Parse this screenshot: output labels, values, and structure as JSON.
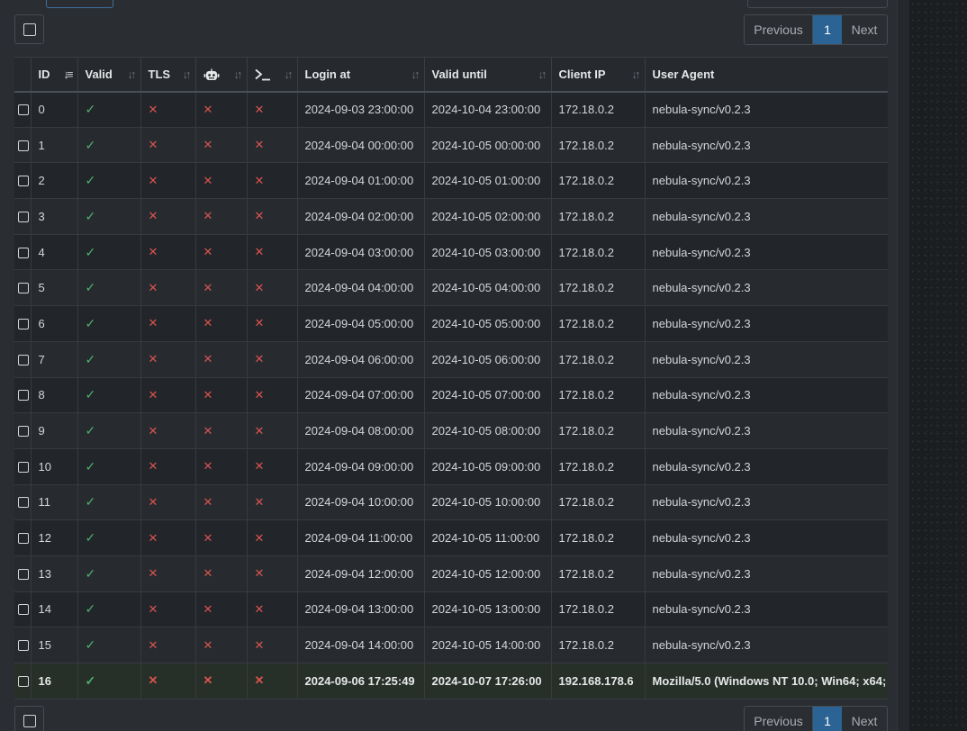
{
  "pagination": {
    "previous": "Previous",
    "page": "1",
    "next": "Next"
  },
  "columns": [
    {
      "key": "select",
      "label": ""
    },
    {
      "key": "id",
      "label": "ID"
    },
    {
      "key": "valid",
      "label": "Valid"
    },
    {
      "key": "tls",
      "label": "TLS"
    },
    {
      "key": "bot",
      "label": "",
      "icon": "robot-icon"
    },
    {
      "key": "cli",
      "label": "",
      "icon": "terminal-icon"
    },
    {
      "key": "login_at",
      "label": "Login at"
    },
    {
      "key": "valid_until",
      "label": "Valid until"
    },
    {
      "key": "client_ip",
      "label": "Client IP"
    },
    {
      "key": "user_agent",
      "label": "User Agent"
    }
  ],
  "symbols": {
    "check": "✓",
    "cross": "✕"
  },
  "rows": [
    {
      "id": "0",
      "valid": true,
      "tls": false,
      "bot": false,
      "cli": false,
      "login_at": "2024-09-03 23:00:00",
      "valid_until": "2024-10-04 23:00:00",
      "client_ip": "172.18.0.2",
      "user_agent": "nebula-sync/v0.2.3"
    },
    {
      "id": "1",
      "valid": true,
      "tls": false,
      "bot": false,
      "cli": false,
      "login_at": "2024-09-04 00:00:00",
      "valid_until": "2024-10-05 00:00:00",
      "client_ip": "172.18.0.2",
      "user_agent": "nebula-sync/v0.2.3"
    },
    {
      "id": "2",
      "valid": true,
      "tls": false,
      "bot": false,
      "cli": false,
      "login_at": "2024-09-04 01:00:00",
      "valid_until": "2024-10-05 01:00:00",
      "client_ip": "172.18.0.2",
      "user_agent": "nebula-sync/v0.2.3"
    },
    {
      "id": "3",
      "valid": true,
      "tls": false,
      "bot": false,
      "cli": false,
      "login_at": "2024-09-04 02:00:00",
      "valid_until": "2024-10-05 02:00:00",
      "client_ip": "172.18.0.2",
      "user_agent": "nebula-sync/v0.2.3"
    },
    {
      "id": "4",
      "valid": true,
      "tls": false,
      "bot": false,
      "cli": false,
      "login_at": "2024-09-04 03:00:00",
      "valid_until": "2024-10-05 03:00:00",
      "client_ip": "172.18.0.2",
      "user_agent": "nebula-sync/v0.2.3"
    },
    {
      "id": "5",
      "valid": true,
      "tls": false,
      "bot": false,
      "cli": false,
      "login_at": "2024-09-04 04:00:00",
      "valid_until": "2024-10-05 04:00:00",
      "client_ip": "172.18.0.2",
      "user_agent": "nebula-sync/v0.2.3"
    },
    {
      "id": "6",
      "valid": true,
      "tls": false,
      "bot": false,
      "cli": false,
      "login_at": "2024-09-04 05:00:00",
      "valid_until": "2024-10-05 05:00:00",
      "client_ip": "172.18.0.2",
      "user_agent": "nebula-sync/v0.2.3"
    },
    {
      "id": "7",
      "valid": true,
      "tls": false,
      "bot": false,
      "cli": false,
      "login_at": "2024-09-04 06:00:00",
      "valid_until": "2024-10-05 06:00:00",
      "client_ip": "172.18.0.2",
      "user_agent": "nebula-sync/v0.2.3"
    },
    {
      "id": "8",
      "valid": true,
      "tls": false,
      "bot": false,
      "cli": false,
      "login_at": "2024-09-04 07:00:00",
      "valid_until": "2024-10-05 07:00:00",
      "client_ip": "172.18.0.2",
      "user_agent": "nebula-sync/v0.2.3"
    },
    {
      "id": "9",
      "valid": true,
      "tls": false,
      "bot": false,
      "cli": false,
      "login_at": "2024-09-04 08:00:00",
      "valid_until": "2024-10-05 08:00:00",
      "client_ip": "172.18.0.2",
      "user_agent": "nebula-sync/v0.2.3"
    },
    {
      "id": "10",
      "valid": true,
      "tls": false,
      "bot": false,
      "cli": false,
      "login_at": "2024-09-04 09:00:00",
      "valid_until": "2024-10-05 09:00:00",
      "client_ip": "172.18.0.2",
      "user_agent": "nebula-sync/v0.2.3"
    },
    {
      "id": "11",
      "valid": true,
      "tls": false,
      "bot": false,
      "cli": false,
      "login_at": "2024-09-04 10:00:00",
      "valid_until": "2024-10-05 10:00:00",
      "client_ip": "172.18.0.2",
      "user_agent": "nebula-sync/v0.2.3"
    },
    {
      "id": "12",
      "valid": true,
      "tls": false,
      "bot": false,
      "cli": false,
      "login_at": "2024-09-04 11:00:00",
      "valid_until": "2024-10-05 11:00:00",
      "client_ip": "172.18.0.2",
      "user_agent": "nebula-sync/v0.2.3"
    },
    {
      "id": "13",
      "valid": true,
      "tls": false,
      "bot": false,
      "cli": false,
      "login_at": "2024-09-04 12:00:00",
      "valid_until": "2024-10-05 12:00:00",
      "client_ip": "172.18.0.2",
      "user_agent": "nebula-sync/v0.2.3"
    },
    {
      "id": "14",
      "valid": true,
      "tls": false,
      "bot": false,
      "cli": false,
      "login_at": "2024-09-04 13:00:00",
      "valid_until": "2024-10-05 13:00:00",
      "client_ip": "172.18.0.2",
      "user_agent": "nebula-sync/v0.2.3"
    },
    {
      "id": "15",
      "valid": true,
      "tls": false,
      "bot": false,
      "cli": false,
      "login_at": "2024-09-04 14:00:00",
      "valid_until": "2024-10-05 14:00:00",
      "client_ip": "172.18.0.2",
      "user_agent": "nebula-sync/v0.2.3"
    },
    {
      "id": "16",
      "valid": true,
      "tls": false,
      "bot": false,
      "cli": false,
      "login_at": "2024-09-06 17:25:49",
      "valid_until": "2024-10-07 17:26:00",
      "client_ip": "192.168.178.6",
      "user_agent": "Mozilla/5.0 (Windows NT 10.0; Win64; x64;",
      "current": true
    }
  ],
  "colors": {
    "accent": "#2b6394",
    "valid": "#4caf6a",
    "invalid": "#d9534f",
    "current_row": "#263029"
  }
}
